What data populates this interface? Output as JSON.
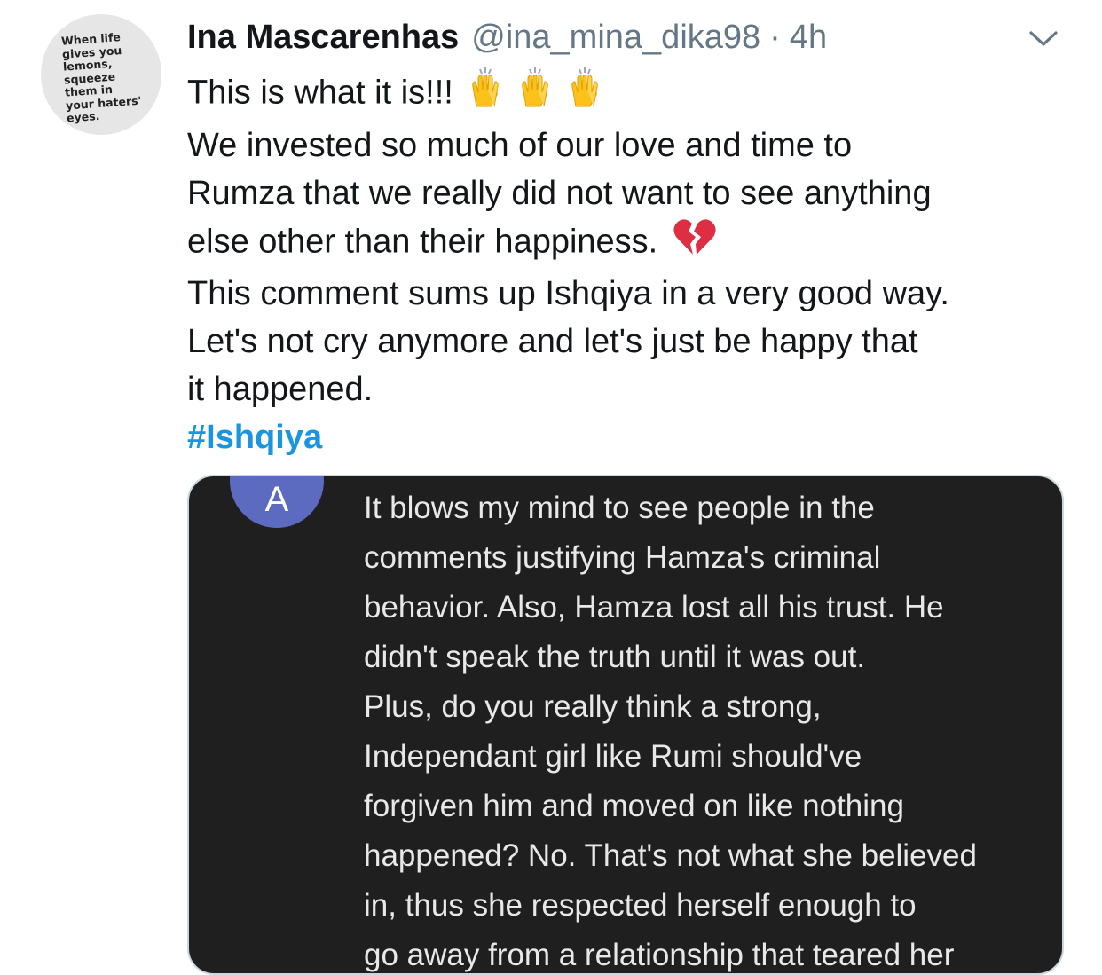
{
  "profile": {
    "avatar_text": "When life\ngives you\nlemons,\nsqueeze\nthem in\nyour haters'\neyes."
  },
  "tweet": {
    "display_name": "Ina Mascarenhas",
    "handle": "@ina_mina_dika98",
    "separator": "·",
    "timestamp": "4h",
    "lines": [
      "This is what it is!!!",
      "We invested so much of our love and time to",
      "Rumza that we really did not want to see anything",
      "else other than their happiness.",
      "This comment sums up Ishqiya in a very good way.",
      "Let's not cry anymore and let's just be happy that",
      "it happened."
    ],
    "hashtag": "#Ishqiya",
    "emojis": {
      "line0": "raising-hands-emoji x3",
      "line3": "broken-heart-emoji"
    }
  },
  "media": {
    "avatar_letter": "A",
    "comment_lines": [
      "It blows my mind to see people in the",
      "comments justifying Hamza's criminal",
      "behavior. Also, Hamza lost all his trust. He",
      "didn't speak the truth until it was out.",
      "Plus, do you really think a strong,",
      "Independant girl like Rumi should've",
      "forgiven him and moved on like nothing",
      "happened? No. That's not what she believed",
      "in, thus she respected herself enough to",
      "go away from a relationship that teared her"
    ]
  },
  "colors": {
    "text": "#14171a",
    "secondary": "#657786",
    "link": "#1b95e0",
    "media_bg": "#1f1f1f",
    "comment_avatar": "#5c6bc0"
  }
}
